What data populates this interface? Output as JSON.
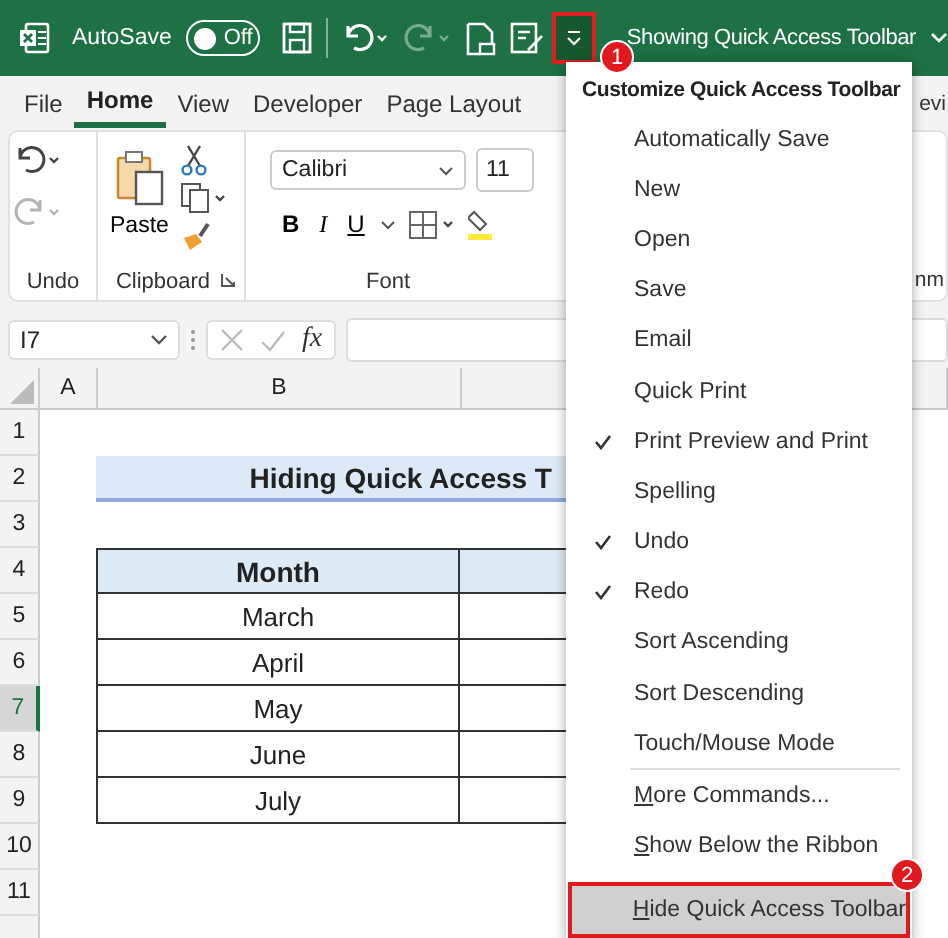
{
  "title_bar": {
    "autosave_label": "AutoSave",
    "autosave": {
      "on": false,
      "label": "Off"
    },
    "redo_disabled": true,
    "doc_title": "Showing Quick Access Toolbar",
    "badge": "1"
  },
  "ribbon_tabs": [
    {
      "label": "File",
      "selected": false
    },
    {
      "label": "Home",
      "selected": true
    },
    {
      "label": "View",
      "selected": false
    },
    {
      "label": "Developer",
      "selected": false
    },
    {
      "label": "Page Layout",
      "selected": false
    }
  ],
  "ribbon_tab_cut": "evi",
  "ribbon": {
    "groups": [
      "Undo",
      "Clipboard",
      "Font"
    ],
    "group_cut": "nm",
    "paste_label": "Paste",
    "font_name": "Calibri",
    "font_size": "11",
    "bold": "B",
    "italic": "I",
    "underline": "U"
  },
  "formula_bar": {
    "name_box": "I7",
    "fx": "fx"
  },
  "sheet": {
    "columns": [
      "A",
      "B"
    ],
    "rows": [
      {
        "label": "1",
        "selected": false
      },
      {
        "label": "2",
        "selected": false
      },
      {
        "label": "3",
        "selected": false
      },
      {
        "label": "4",
        "selected": false
      },
      {
        "label": "5",
        "selected": false
      },
      {
        "label": "6",
        "selected": false
      },
      {
        "label": "7",
        "selected": true
      },
      {
        "label": "8",
        "selected": false
      },
      {
        "label": "9",
        "selected": false
      },
      {
        "label": "10",
        "selected": false
      },
      {
        "label": "11",
        "selected": false
      }
    ],
    "title": "Hiding Quick Access T",
    "table_header": "Month",
    "months": [
      "March",
      "April",
      "May",
      "June",
      "July"
    ]
  },
  "menu": {
    "title": "Customize Quick Access Toolbar",
    "items": [
      {
        "kind": "toggle",
        "label": "Automatically Save",
        "checked": false
      },
      {
        "kind": "toggle",
        "label": "New",
        "checked": false
      },
      {
        "kind": "toggle",
        "label": "Open",
        "checked": false
      },
      {
        "kind": "toggle",
        "label": "Save",
        "checked": false
      },
      {
        "kind": "toggle",
        "label": "Email",
        "checked": false
      },
      {
        "kind": "toggle",
        "label": "Quick Print",
        "checked": false
      },
      {
        "kind": "toggle",
        "label": "Print Preview and Print",
        "checked": true
      },
      {
        "kind": "toggle",
        "label": "Spelling",
        "checked": false
      },
      {
        "kind": "toggle",
        "label": "Undo",
        "checked": true
      },
      {
        "kind": "toggle",
        "label": "Redo",
        "checked": true
      },
      {
        "kind": "toggle",
        "label": "Sort Ascending",
        "checked": false
      },
      {
        "kind": "toggle",
        "label": "Sort Descending",
        "checked": false
      },
      {
        "kind": "toggle",
        "label": "Touch/Mouse Mode",
        "checked": false
      },
      {
        "kind": "action",
        "key": "M",
        "label": "ore Commands...",
        "highlighted": false
      },
      {
        "kind": "action",
        "key": "S",
        "label": "how Below the Ribbon",
        "highlighted": false
      },
      {
        "kind": "action",
        "key": "H",
        "label": "ide Quick Access Toolbar",
        "highlighted": true,
        "badge": "2"
      }
    ]
  }
}
